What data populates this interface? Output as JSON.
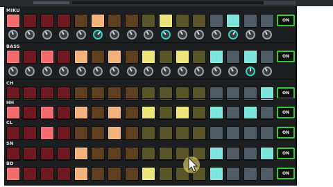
{
  "on_label": "ON",
  "colors": {
    "red_on": "#f06a6e",
    "red_off": "#6e1a20",
    "orange_on": "#f2b279",
    "orange_off": "#5e4020",
    "yellow_on": "#eee57a",
    "yellow_off": "#585628",
    "teal_on": "#7ce4dc",
    "teal_off": "#4e5a64",
    "on_border": "#35c83a"
  },
  "tracks": [
    {
      "name": "MIKU",
      "pads": [
        1,
        0,
        0,
        0,
        0,
        1,
        0,
        0,
        0,
        1,
        0,
        0,
        0,
        1,
        0,
        0
      ],
      "has_knobs": true
    },
    {
      "name": "BASS",
      "pads": [
        1,
        0,
        1,
        0,
        1,
        0,
        1,
        0,
        1,
        0,
        1,
        0,
        1,
        0,
        1,
        0
      ],
      "has_knobs": true
    },
    {
      "name": "CH",
      "pads": [
        0,
        0,
        0,
        0,
        0,
        0,
        0,
        0,
        0,
        0,
        0,
        0,
        0,
        0,
        0,
        1
      ],
      "has_knobs": false
    },
    {
      "name": "HH",
      "pads": [
        1,
        0,
        1,
        0,
        1,
        0,
        1,
        0,
        1,
        0,
        1,
        0,
        1,
        0,
        1,
        0
      ],
      "has_knobs": false
    },
    {
      "name": "CL",
      "pads": [
        0,
        0,
        1,
        0,
        0,
        0,
        1,
        0,
        0,
        0,
        0,
        0,
        0,
        0,
        0,
        0
      ],
      "has_knobs": false
    },
    {
      "name": "SN",
      "pads": [
        0,
        0,
        0,
        0,
        1,
        0,
        0,
        0,
        0,
        0,
        0,
        0,
        1,
        0,
        0,
        1
      ],
      "has_knobs": false
    },
    {
      "name": "BD",
      "pads": [
        1,
        0,
        0,
        0,
        1,
        0,
        0,
        0,
        1,
        0,
        0,
        0,
        1,
        0,
        0,
        0
      ],
      "has_knobs": false
    }
  ],
  "knob_rows": [
    {
      "highlight": [
        0,
        0,
        0,
        0,
        0,
        1,
        0,
        0,
        0,
        1,
        0,
        0,
        0,
        1,
        0,
        0
      ],
      "angles": [
        -20,
        -30,
        -30,
        -30,
        -30,
        40,
        -30,
        -30,
        -30,
        -40,
        -30,
        -30,
        -30,
        30,
        -30,
        -30
      ]
    },
    {
      "highlight": [
        0,
        0,
        0,
        0,
        0,
        0,
        0,
        0,
        0,
        0,
        0,
        0,
        0,
        0,
        1,
        0
      ],
      "angles": [
        -30,
        -30,
        -30,
        -30,
        -30,
        -30,
        -30,
        -30,
        -30,
        -30,
        -30,
        -30,
        -30,
        -30,
        0,
        -30
      ]
    }
  ]
}
